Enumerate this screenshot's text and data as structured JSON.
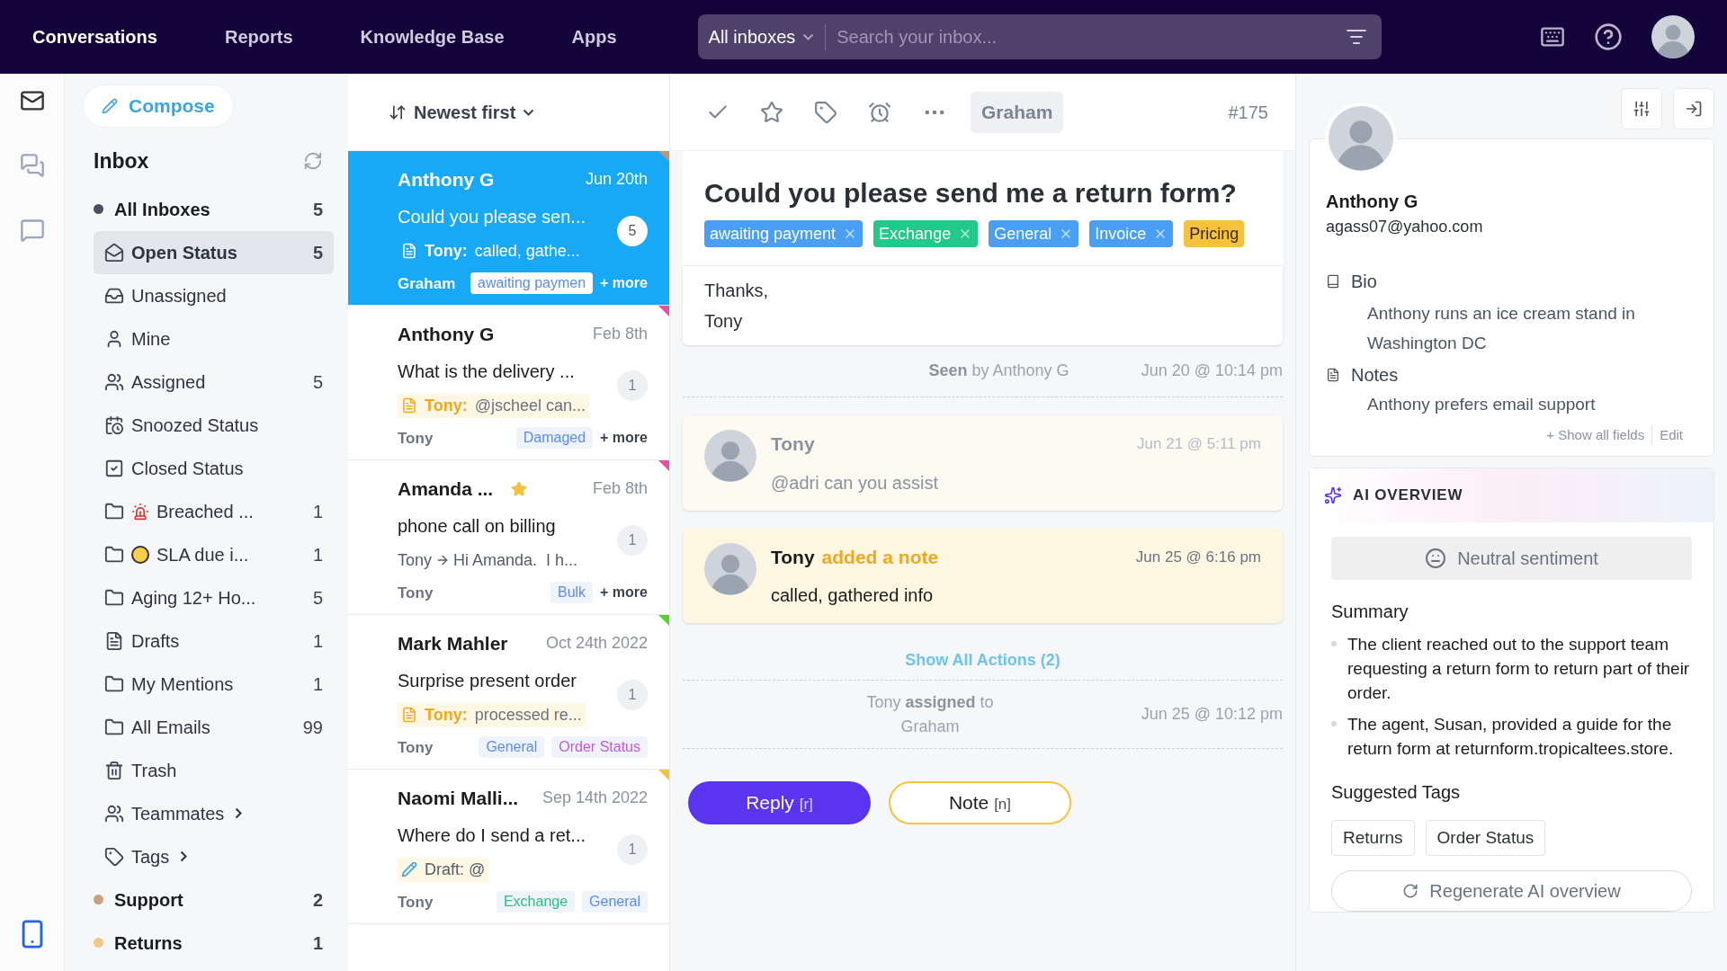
{
  "nav": {
    "tabs": [
      {
        "label": "Conversations",
        "selected": true
      },
      {
        "label": "Reports",
        "selected": false
      },
      {
        "label": "Knowledge Base",
        "selected": false
      },
      {
        "label": "Apps",
        "selected": false
      }
    ],
    "search": {
      "scope": "All inboxes",
      "placeholder": "Search your inbox..."
    }
  },
  "sidebar": {
    "compose": "Compose",
    "title": "Inbox",
    "items": [
      {
        "kind": "dot",
        "label": "All Inboxes",
        "count": "5",
        "color": "#4b5060",
        "selected": false
      },
      {
        "kind": "open",
        "label": "Open Status",
        "count": "5",
        "selected": true
      },
      {
        "kind": "unassigned",
        "label": "Unassigned",
        "selected": false
      },
      {
        "kind": "mine",
        "label": "Mine",
        "selected": false
      },
      {
        "kind": "assigned",
        "label": "Assigned",
        "count": "5",
        "selected": false
      },
      {
        "kind": "snoozed",
        "label": "Snoozed Status",
        "selected": false
      },
      {
        "kind": "closed",
        "label": "Closed Status",
        "selected": false
      },
      {
        "kind": "folder-breached",
        "label": "Breached ...",
        "count": "1",
        "selected": false
      },
      {
        "kind": "folder-sla",
        "label": "SLA due i...",
        "count": "1",
        "selected": false
      },
      {
        "kind": "folder",
        "label": "Aging 12+ Ho...",
        "count": "5",
        "selected": false
      },
      {
        "kind": "drafts",
        "label": "Drafts",
        "count": "1",
        "selected": false
      },
      {
        "kind": "folder",
        "label": "My Mentions",
        "count": "1",
        "selected": false
      },
      {
        "kind": "folder",
        "label": "All Emails",
        "count": "99",
        "selected": false
      },
      {
        "kind": "trash",
        "label": "Trash",
        "selected": false
      },
      {
        "kind": "teammates",
        "label": "Teammates",
        "expanded": false,
        "selected": false
      },
      {
        "kind": "tags",
        "label": "Tags",
        "expanded": false,
        "selected": false
      },
      {
        "kind": "dot",
        "label": "Support",
        "count": "2",
        "color": "#c8a27f",
        "selected": false
      },
      {
        "kind": "dot",
        "label": "Returns",
        "count": "1",
        "color": "#f0c987",
        "selected": false
      }
    ]
  },
  "list": {
    "sort": "Newest first",
    "conversations": [
      {
        "name": "Anthony G",
        "date": "Jun 20th",
        "subject": "Could you please sen...",
        "preview": {
          "kind": "note",
          "author": "Tony:",
          "text": "called, gathe..."
        },
        "count": "5",
        "assignee": "Graham",
        "tags": [
          {
            "label": "awaiting paymen",
            "color": "#5b8def"
          }
        ],
        "more": "+ more",
        "starred": false,
        "selected": true,
        "color": "#b8977a"
      },
      {
        "name": "Anthony G",
        "date": "Feb 8th",
        "subject": "What is the delivery ...",
        "preview": {
          "kind": "note",
          "author": "Tony:",
          "text": "@jscheel can..."
        },
        "count": "1",
        "assignee": "Tony",
        "tags": [
          {
            "label": "Damaged",
            "color": "#5b8def"
          }
        ],
        "more": "+ more",
        "starred": false,
        "selected": false,
        "color": "#e84fa0"
      },
      {
        "name": "Amanda ...",
        "date": "Feb 8th",
        "subject": "phone call on billing",
        "preview": {
          "kind": "message",
          "author": "Tony",
          "text": "Hi Amanda.  I h..."
        },
        "count": "1",
        "assignee": "Tony",
        "tags": [
          {
            "label": "Bulk",
            "color": "#5b8def"
          }
        ],
        "more": "+ more",
        "starred": true,
        "selected": false,
        "color": "#e84fa0"
      },
      {
        "name": "Mark Mahler",
        "date": "Oct 24th 2022",
        "subject": "Surprise present order",
        "preview": {
          "kind": "note",
          "author": "Tony:",
          "text": "processed re..."
        },
        "count": "1",
        "assignee": "Tony",
        "tags": [
          {
            "label": "General",
            "color": "#5b8def"
          },
          {
            "label": "Order Status",
            "color": "#c45ad0"
          }
        ],
        "starred": false,
        "selected": false,
        "color": "#5ccf3a"
      },
      {
        "name": "Naomi Malli...",
        "date": "Sep 14th 2022",
        "subject": "Where do I send a ret...",
        "preview": {
          "kind": "draft",
          "text": "Draft: @"
        },
        "count": "1",
        "assignee": "Tony",
        "tags": [
          {
            "label": "Exchange",
            "color": "#2fbf7f"
          },
          {
            "label": "General",
            "color": "#5b8def"
          }
        ],
        "starred": false,
        "selected": false,
        "color": "#f5c23e"
      }
    ]
  },
  "thread": {
    "assignee": "Graham",
    "number": "#175",
    "subject": "Could you please send me a return form?",
    "tags": [
      {
        "label": "awaiting payment",
        "color": "#4a9ff5"
      },
      {
        "label": "Exchange",
        "color": "#22c98a"
      },
      {
        "label": "General",
        "color": "#4a9ff5"
      },
      {
        "label": "Invoice",
        "color": "#4a9ff5"
      },
      {
        "label": "Pricing",
        "color": "#f5c23e"
      }
    ],
    "body": [
      "Thanks,",
      "Tony"
    ],
    "events": [
      {
        "kind": "seen",
        "text": "**Seen** by Anthony G",
        "time": "Jun 20 @ 10:14 pm"
      },
      {
        "kind": "mention",
        "author": "Tony",
        "text": "@adri can you assist",
        "time": "Jun 21 @ 5:11 pm"
      },
      {
        "kind": "note",
        "author": "Tony",
        "action": "added a note",
        "text": "called, gathered info",
        "time": "Jun 25 @ 6:16 pm"
      },
      {
        "kind": "link",
        "text": "Show All Actions (2)"
      },
      {
        "kind": "assign",
        "text": "Tony **assigned** to Graham",
        "time": "Jun 25 @ 10:12 pm"
      }
    ],
    "buttons": [
      {
        "kind": "reply",
        "label": "Reply",
        "key": "[r]"
      },
      {
        "kind": "note",
        "label": "Note",
        "key": "[n]"
      }
    ]
  },
  "contact": {
    "name": "Anthony G",
    "email": "agass07@yahoo.com",
    "bio_label": "Bio",
    "bio": "Anthony runs an ice cream stand in Washington DC",
    "notes_label": "Notes",
    "notes": "Anthony prefers email support",
    "show_all": "+ Show all fields",
    "edit": "Edit"
  },
  "ai": {
    "title": "AI OVERVIEW",
    "sentiment": "Neutral sentiment",
    "summary_title": "Summary",
    "summary": [
      "The client reached out to the support team requesting a return form to return part of their order.",
      "The agent, Susan, provided a guide for the return form at returnform.tropicaltees.store."
    ],
    "tags_title": "Suggested Tags",
    "tags": [
      "Returns",
      "Order Status"
    ],
    "regenerate": "Regenerate AI overview"
  }
}
